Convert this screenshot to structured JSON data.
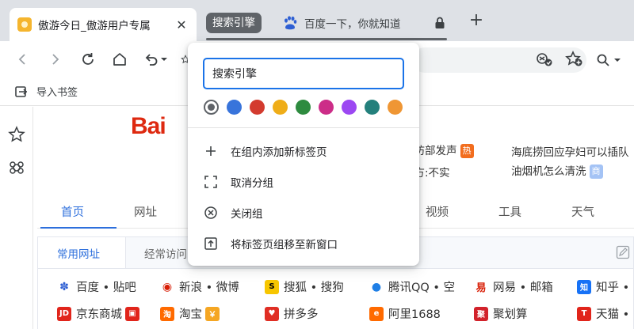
{
  "tabs": [
    {
      "title": "傲游今日_傲游用户专属"
    },
    {
      "title": "百度一下，你就知道"
    }
  ],
  "tab_group": {
    "name": "搜索引擎"
  },
  "icons": {
    "back": "arrow-left-icon",
    "forward": "arrow-right-icon",
    "reload": "reload-icon",
    "home": "home-icon",
    "undo": "undo-icon",
    "star": "star-icon",
    "lock": "lock-icon",
    "new_tab": "plus-icon"
  },
  "bookmarks_bar": {
    "import_label": "导入书签"
  },
  "search_button": {
    "glyph": "Q·"
  },
  "baidu": {
    "logo": "Bai"
  },
  "hot_list": [
    {
      "text": "国防部发声",
      "badge": "热",
      "badge_color": "#f26d1e"
    },
    {
      "text": "海底捞回应孕妇可以插队"
    },
    {
      "text": "警方:不实"
    },
    {
      "text": "油烟机怎么清洗",
      "badge": "商",
      "badge_color": "#a4c3f5"
    }
  ],
  "nav": {
    "items": [
      "首页",
      "网址",
      "视频",
      "工具",
      "天气"
    ]
  },
  "subtabs": {
    "items": [
      "常用网址",
      "经常访问"
    ]
  },
  "sites": {
    "row1": [
      "百度 • 贴吧",
      "新浪 • 微博",
      "搜狐 • 搜狗",
      "腾讯QQ • 空",
      "网易 • 邮箱",
      "知乎 •"
    ],
    "row2": [
      "京东商城",
      "淘宝",
      "拼多多",
      "阿里1688",
      "聚划算",
      "天猫 •"
    ]
  },
  "group_editor": {
    "name_value": "搜索引擎",
    "colors": [
      "#5f6368",
      "#3874db",
      "#d33b2f",
      "#efad18",
      "#2e8b3f",
      "#cc2d88",
      "#9c48f2",
      "#24807c",
      "#ef9634"
    ],
    "menu": [
      {
        "label": "在组内添加新标签页",
        "icon": "plus-icon"
      },
      {
        "label": "取消分组",
        "icon": "ungroup-icon"
      },
      {
        "label": "关闭组",
        "icon": "close-circle-icon"
      },
      {
        "label": "将标签页组移至新窗口",
        "icon": "move-window-icon"
      }
    ]
  }
}
